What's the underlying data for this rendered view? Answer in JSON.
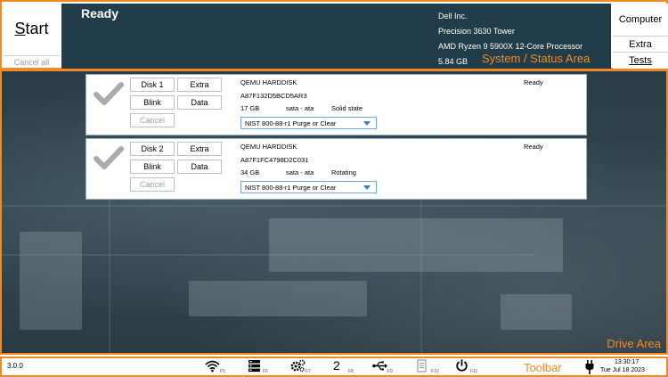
{
  "top": {
    "start_label": "Start",
    "cancel_all_label": "Cancel all",
    "status": "Ready",
    "system": {
      "manufacturer": "Dell Inc.",
      "model": "Precision 3630 Tower",
      "cpu": "AMD Ryzen 9 5900X 12-Core Processor",
      "memory": "5.84 GB"
    },
    "area_label": "System / Status Area",
    "menu": {
      "computer_label": "Computer",
      "extra_label": "Extra",
      "tests_label": "Tests"
    }
  },
  "drives": [
    {
      "disk_label": "Disk 1",
      "extra_label": "Extra",
      "blink_label": "Blink",
      "data_label": "Data",
      "cancel_label": "Cancel",
      "model": "QEMU HARDDISK",
      "serial": "A87F132D5BCD5AR3",
      "size": "17 GB",
      "interface": "sata - ata",
      "kind": "Solid state",
      "status": "Ready",
      "method": "NIST 800-88-r1 Purge or Clear"
    },
    {
      "disk_label": "Disk 2",
      "extra_label": "Extra",
      "blink_label": "Blink",
      "data_label": "Data",
      "cancel_label": "Cancel",
      "model": "QEMU HARDDISK",
      "serial": "A87F1FC4798D2C031",
      "size": "34 GB",
      "interface": "sata - ata",
      "kind": "Rotating",
      "status": "Ready",
      "method": "NIST 800-88-r1 Purge or Clear"
    }
  ],
  "drive_area_label": "Drive Area",
  "toolbar": {
    "version": "3.0.0",
    "label": "Toolbar",
    "items": [
      {
        "icon": "wifi-icon",
        "key": "F5"
      },
      {
        "icon": "server-icon",
        "key": "F6"
      },
      {
        "icon": "settings-icon",
        "key": "F7"
      },
      {
        "icon": "number-two-icon",
        "text": "2",
        "key": "F8"
      },
      {
        "icon": "usb-icon",
        "key": "F9"
      },
      {
        "icon": "document-icon",
        "key": "F10"
      },
      {
        "icon": "power-icon",
        "key": "F11"
      }
    ],
    "time": "13:30:17",
    "date": "Tue Jul 18 2023"
  },
  "colors": {
    "accent": "#f08a24",
    "status_bg": "#223d4a",
    "select_border": "#6fa6d6"
  }
}
